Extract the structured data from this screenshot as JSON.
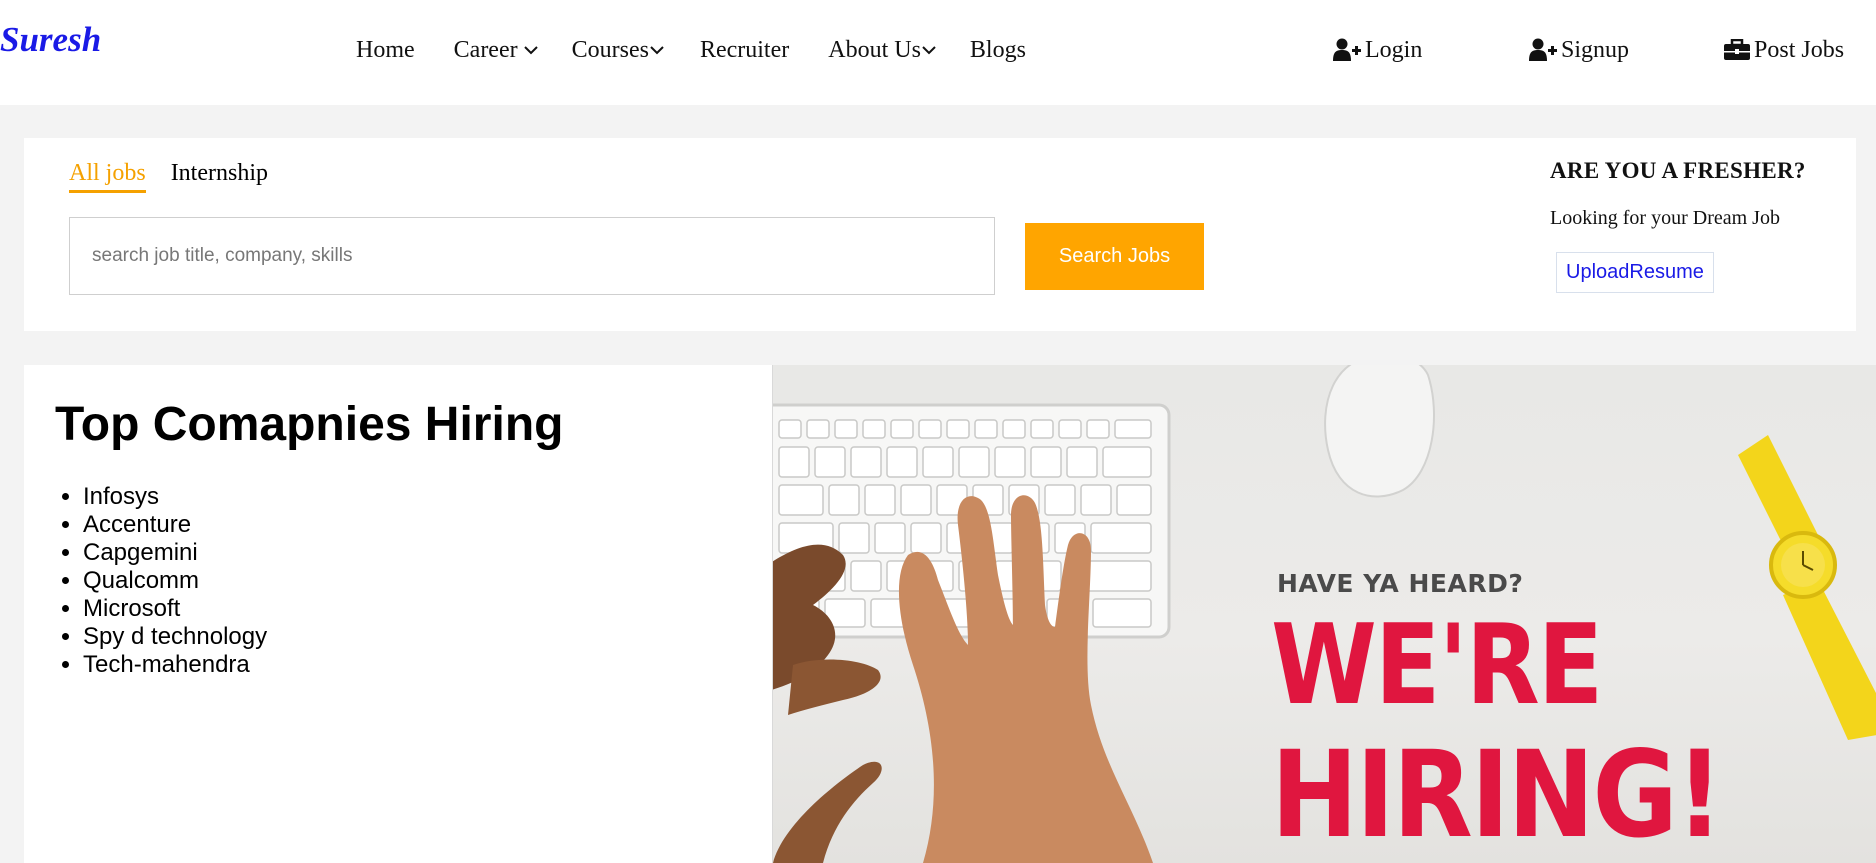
{
  "header": {
    "brand": "Suresh",
    "nav": [
      {
        "label": "Home",
        "dropdown": false
      },
      {
        "label": "Career",
        "dropdown": true
      },
      {
        "label": "Courses",
        "dropdown": true
      },
      {
        "label": "Recruiter",
        "dropdown": false
      },
      {
        "label": "About Us",
        "dropdown": true
      },
      {
        "label": "Blogs",
        "dropdown": false
      }
    ],
    "login_label": "Login",
    "signup_label": "Signup",
    "post_jobs_label": "Post Jobs"
  },
  "search": {
    "tabs": [
      {
        "label": "All jobs",
        "active": true
      },
      {
        "label": "Internship",
        "active": false
      }
    ],
    "placeholder": "search job title, company, skills",
    "value": "",
    "button_label": "Search Jobs"
  },
  "fresher": {
    "title": "ARE YOU A FRESHER?",
    "subtitle": "Looking for your Dream Job",
    "upload_label": "UploadResume"
  },
  "companies": {
    "title": "Top Comapnies Hiring",
    "items": [
      "Infosys",
      "Accenture",
      "Capgemini",
      "Qualcomm",
      "Microsoft",
      "Spy d technology",
      "Tech-mahendra"
    ]
  },
  "hiring_image": {
    "small_text": "HAVE YA HEARD?",
    "line1": "WE'RE",
    "line2": "HIRING!"
  },
  "colors": {
    "brand": "#1a1ae6",
    "accent": "#ffa500",
    "hiring_red": "#e0163f"
  }
}
